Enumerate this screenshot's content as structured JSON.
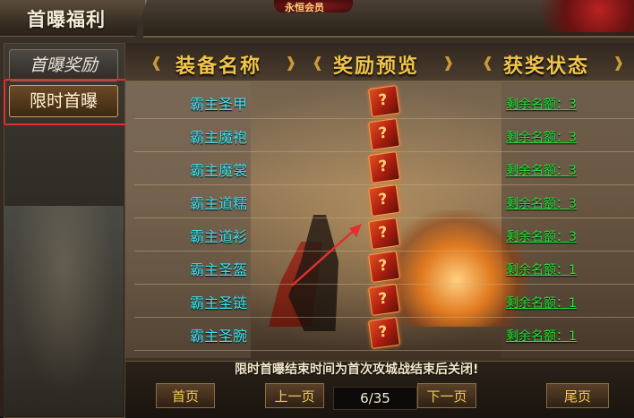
{
  "window": {
    "title": "首曝福利",
    "top_badge": "永恒会员"
  },
  "sidebar": {
    "items": [
      {
        "label": "首曝奖励",
        "active": false
      },
      {
        "label": "限时首曝",
        "active": true
      }
    ]
  },
  "table": {
    "headers": [
      "装备名称",
      "奖励预览",
      "获奖状态"
    ],
    "rows": [
      {
        "name": "霸主圣甲",
        "preview_icon": "gift-icon",
        "status": "剩余名额：3"
      },
      {
        "name": "霸主魔袍",
        "preview_icon": "gift-icon",
        "status": "剩余名额：3"
      },
      {
        "name": "霸主魔裳",
        "preview_icon": "gift-icon",
        "status": "剩余名额：3"
      },
      {
        "name": "霸主道糯",
        "preview_icon": "gift-icon",
        "status": "剩余名额：3"
      },
      {
        "name": "霸主道衫",
        "preview_icon": "gift-icon",
        "status": "剩余名额：3"
      },
      {
        "name": "霸主圣盔",
        "preview_icon": "gift-icon",
        "status": "剩余名额：1"
      },
      {
        "name": "霸主圣链",
        "preview_icon": "gift-icon",
        "status": "剩余名额：1"
      },
      {
        "name": "霸主圣腕",
        "preview_icon": "gift-icon",
        "status": "剩余名额：1"
      }
    ]
  },
  "footer": {
    "notice": "限时首曝结束时间为首次攻城战结束后关闭!",
    "first_label": "首页",
    "prev_label": "上一页",
    "page_indicator": "6/35",
    "next_label": "下一页",
    "last_label": "尾页"
  },
  "colors": {
    "header_gold": "#f1c44a",
    "item_cyan": "#3fe2f0",
    "status_green": "#24e03a",
    "highlight_red": "#e23030"
  }
}
